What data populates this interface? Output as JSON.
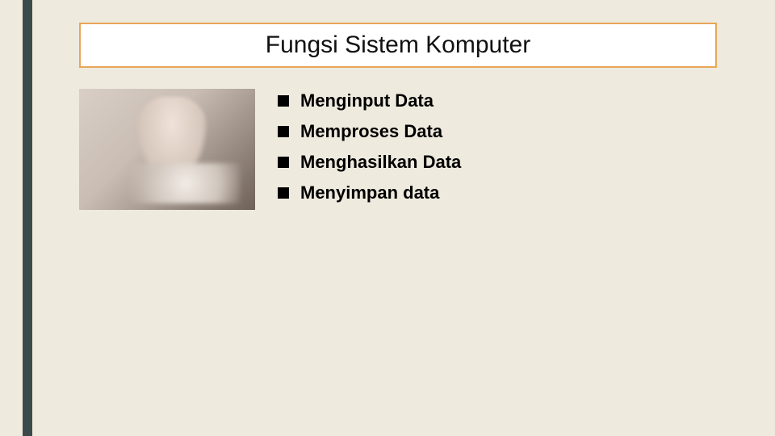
{
  "title": "Fungsi Sistem Komputer",
  "bullets": {
    "b0": "Menginput Data",
    "b1": "Memproses Data",
    "b2": "Menghasilkan Data",
    "b3": "Menyimpan data"
  }
}
